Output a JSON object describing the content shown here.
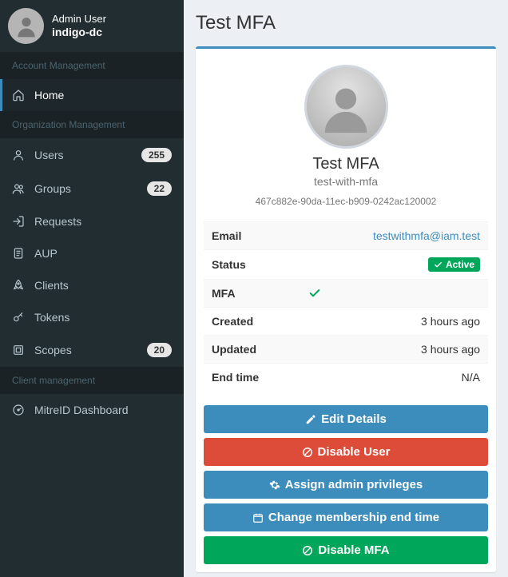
{
  "user_panel": {
    "name": "Admin User",
    "org": "indigo-dc"
  },
  "sidebar": {
    "sections": [
      {
        "header": "Account Management",
        "items": [
          {
            "icon": "home",
            "label": "Home",
            "active": true
          }
        ]
      },
      {
        "header": "Organization Management",
        "items": [
          {
            "icon": "user",
            "label": "Users",
            "badge": "255"
          },
          {
            "icon": "users",
            "label": "Groups",
            "badge": "22"
          },
          {
            "icon": "signin",
            "label": "Requests"
          },
          {
            "icon": "file",
            "label": "AUP"
          },
          {
            "icon": "rocket",
            "label": "Clients"
          },
          {
            "icon": "key",
            "label": "Tokens"
          },
          {
            "icon": "scope",
            "label": "Scopes",
            "badge": "20"
          }
        ]
      },
      {
        "header": "Client management",
        "items": [
          {
            "icon": "dashboard",
            "label": "MitreID Dashboard"
          }
        ]
      }
    ]
  },
  "page": {
    "title": "Test MFA"
  },
  "profile": {
    "display_name": "Test MFA",
    "username": "test-with-mfa",
    "uuid": "467c882e-90da-11ec-b909-0242ac120002",
    "rows": {
      "email_label": "Email",
      "email_value": "testwithmfa@iam.test",
      "status_label": "Status",
      "status_value": "Active",
      "mfa_label": "MFA",
      "created_label": "Created",
      "created_value": "3 hours ago",
      "updated_label": "Updated",
      "updated_value": "3 hours ago",
      "endtime_label": "End time",
      "endtime_value": "N/A"
    }
  },
  "actions": {
    "edit": "Edit Details",
    "disable_user": "Disable User",
    "assign_admin": "Assign admin privileges",
    "change_end": "Change membership end time",
    "disable_mfa": "Disable MFA"
  }
}
